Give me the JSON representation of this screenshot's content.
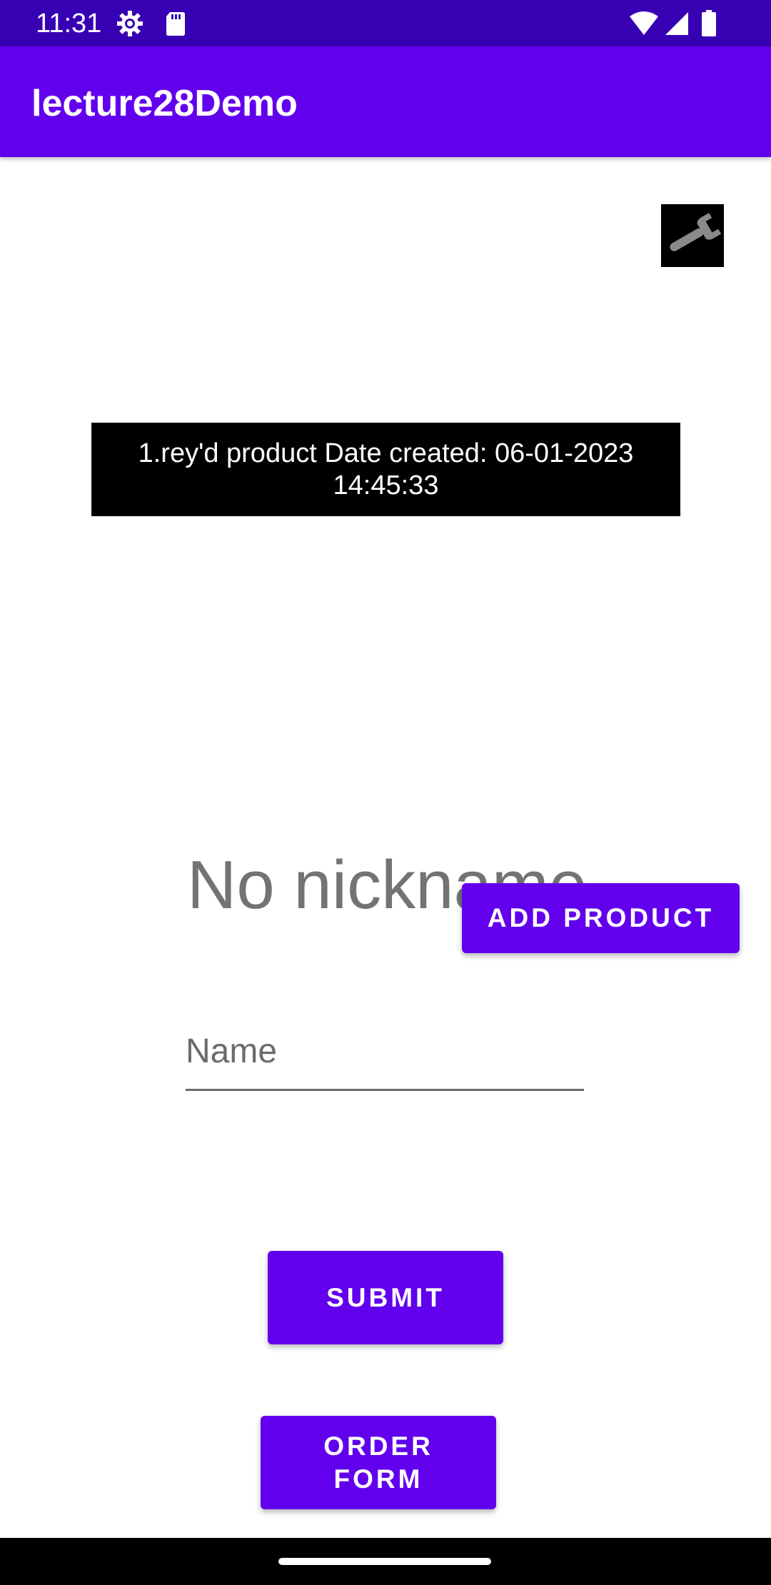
{
  "status_bar": {
    "time": "11:31",
    "icons": [
      "settings-icon",
      "sd-card-icon",
      "wifi-icon",
      "signal-icon",
      "battery-icon"
    ]
  },
  "app_bar": {
    "title": "lecture28Demo"
  },
  "wrench_image": {
    "icon": "wrench-icon"
  },
  "product": {
    "text": "1.rey'd product Date created: 06-01-2023 14:45:33"
  },
  "nickname": {
    "text": "No nickname"
  },
  "buttons": {
    "add_product": "ADD PRODUCT",
    "submit": "SUBMIT",
    "order_form": "ORDER FORM"
  },
  "name_field": {
    "value": "",
    "placeholder": "Name"
  },
  "colors": {
    "primary": "#6200ee",
    "primary_dark": "#3700b3",
    "text_gray": "#737373"
  }
}
